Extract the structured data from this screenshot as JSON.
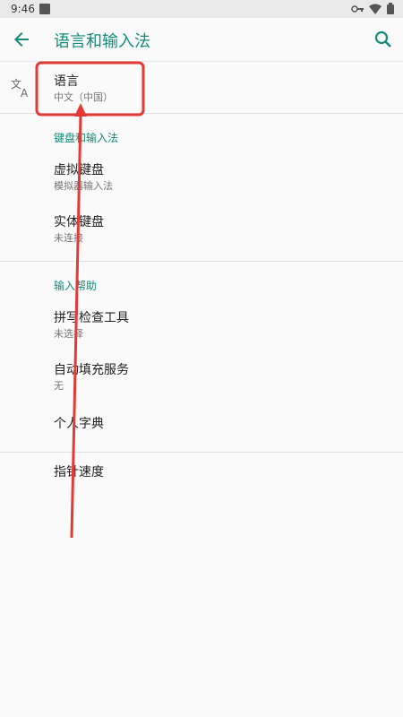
{
  "status_bar": {
    "time": "9:46"
  },
  "app_bar": {
    "title": "语言和输入法"
  },
  "language": {
    "title": "语言",
    "summary": "中文（中国）"
  },
  "keyboard_category": {
    "title": "键盘和输入法",
    "items": [
      {
        "title": "虚拟键盘",
        "summary": "模拟器输入法"
      },
      {
        "title": "实体键盘",
        "summary": "未连接"
      }
    ]
  },
  "input_assist_category": {
    "title": "输入帮助",
    "items": [
      {
        "title": "拼写检查工具",
        "summary": "未选择"
      },
      {
        "title": "自动填充服务",
        "summary": "无"
      },
      {
        "title": "个人字典"
      }
    ]
  },
  "pointer_speed": {
    "title": "指针速度"
  },
  "colors": {
    "accent": "#138a7a",
    "highlight": "#e53935"
  }
}
